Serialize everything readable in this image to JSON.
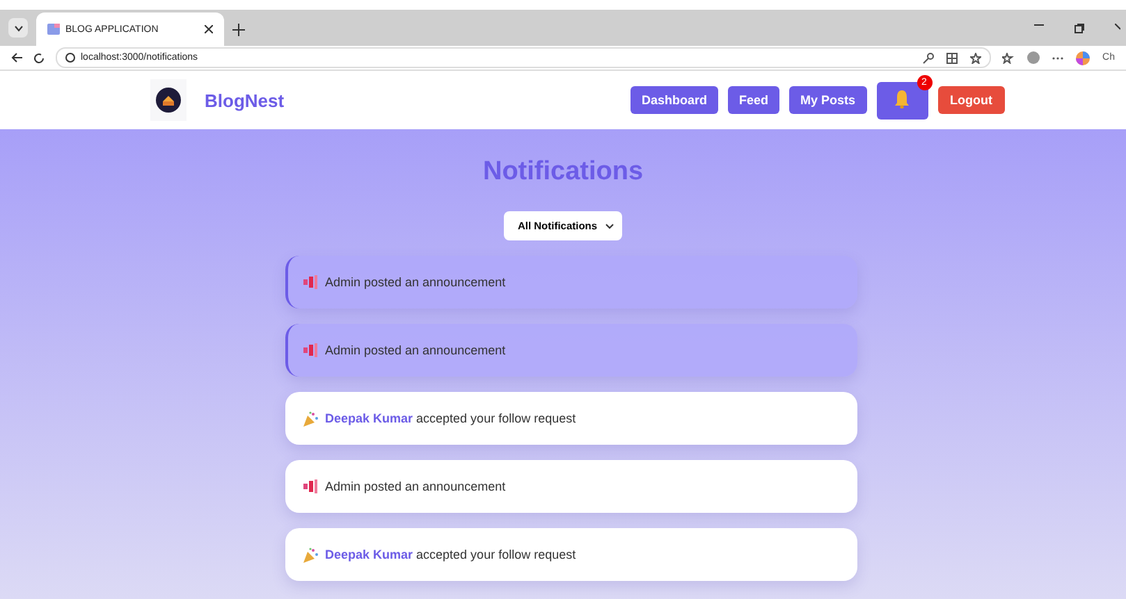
{
  "browser": {
    "tab_title": "BLOG APPLICATION",
    "url": "localhost:3000/notifications",
    "profile_label": "Ch"
  },
  "nav": {
    "brand": "BlogNest",
    "links": [
      {
        "label": "Dashboard",
        "kind": "link"
      },
      {
        "label": "Feed",
        "kind": "link"
      },
      {
        "label": "My Posts",
        "kind": "link"
      },
      {
        "kind": "bell",
        "badge": "2"
      },
      {
        "label": "Logout",
        "kind": "logout"
      }
    ]
  },
  "heading": "Notifications",
  "filter": {
    "value": "All Notifications"
  },
  "notifications": [
    {
      "kind": "announcement",
      "unread": true,
      "text": "Admin posted an announcement"
    },
    {
      "kind": "announcement",
      "unread": true,
      "text": "Admin posted an announcement"
    },
    {
      "kind": "follow",
      "unread": false,
      "user": "Deepak Kumar",
      "text": "accepted your follow request"
    },
    {
      "kind": "announcement",
      "unread": false,
      "text": "Admin posted an announcement"
    },
    {
      "kind": "follow",
      "unread": false,
      "user": "Deepak Kumar",
      "text": "accepted your follow request"
    }
  ]
}
